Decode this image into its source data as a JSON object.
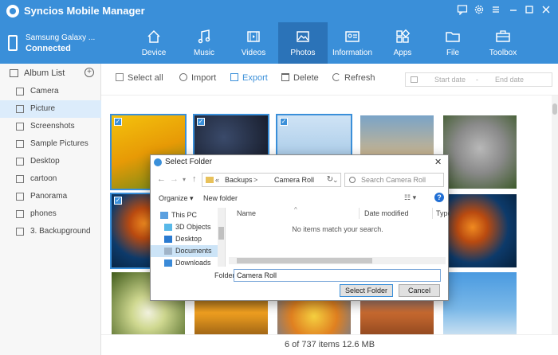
{
  "app": {
    "title": "Syncios Mobile Manager"
  },
  "device": {
    "name": "Samsung Galaxy ...",
    "status": "Connected"
  },
  "nav": {
    "tabs": [
      {
        "label": "Device",
        "icon": "home-icon"
      },
      {
        "label": "Music",
        "icon": "music-icon"
      },
      {
        "label": "Videos",
        "icon": "video-icon"
      },
      {
        "label": "Photos",
        "icon": "photo-icon",
        "active": true
      },
      {
        "label": "Information",
        "icon": "contact-card-icon"
      },
      {
        "label": "Apps",
        "icon": "apps-icon"
      },
      {
        "label": "File",
        "icon": "folder-icon"
      },
      {
        "label": "Toolbox",
        "icon": "toolbox-icon"
      }
    ]
  },
  "sidebar": {
    "header": "Album List",
    "items": [
      {
        "label": "Camera"
      },
      {
        "label": "Picture",
        "active": true
      },
      {
        "label": "Screenshots"
      },
      {
        "label": "Sample Pictures"
      },
      {
        "label": "Desktop"
      },
      {
        "label": "cartoon"
      },
      {
        "label": "Panorama"
      },
      {
        "label": "phones"
      },
      {
        "label": "3. Backupground"
      }
    ]
  },
  "toolbar": {
    "select_all": "Select all",
    "import": "Import",
    "export": "Export",
    "delete": "Delete",
    "refresh": "Refresh",
    "start_date": "Start date",
    "end_date": "End date",
    "date_sep": "-"
  },
  "status": {
    "text": "6 of 737 items 12.6 MB"
  },
  "colors": {
    "accent": "#3a8fd9",
    "accent_dark": "#2b73b8"
  },
  "dialog": {
    "title": "Select Folder",
    "path": {
      "prefix": "«",
      "part1": "Backups",
      "sep": ">",
      "part2": "Camera Roll"
    },
    "search_placeholder": "Search Camera Roll",
    "organize": "Organize ▾",
    "new_folder": "New folder",
    "help": "?",
    "tree": [
      {
        "label": "This PC"
      },
      {
        "label": "3D Objects"
      },
      {
        "label": "Desktop"
      },
      {
        "label": "Documents",
        "active": true
      },
      {
        "label": "Downloads"
      }
    ],
    "columns": {
      "name": "Name",
      "date": "Date modified",
      "type": "Type"
    },
    "empty_text": "No items match your search.",
    "folder_label": "Folder:",
    "folder_value": "Camera Roll",
    "select_button": "Select Folder",
    "cancel_button": "Cancel"
  }
}
